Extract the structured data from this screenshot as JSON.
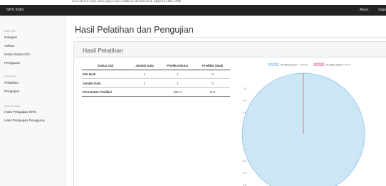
{
  "browser": {
    "url_text": "localhost/spk-knn/app/user/admin/dashboard.php?id=1&r=340"
  },
  "topbar": {
    "brand": "SPK KNN",
    "links": [
      "Akun",
      "Sign"
    ]
  },
  "sidebar": {
    "sections": [
      {
        "title": "MASTER",
        "items": [
          "Kategori",
          "Atribut",
          "Kelas Status Gizi",
          "Pengguna"
        ]
      },
      {
        "title": "PROSES",
        "items": [
          "Pelatihan",
          "Pengujian"
        ]
      },
      {
        "title": "PENGUJIAN",
        "items": [
          "Hasil Pengujian KNN",
          "Hasil Pengujian Pengguna"
        ]
      }
    ]
  },
  "page": {
    "title": "Hasil Pelatihan dan Pengujian"
  },
  "panel": {
    "title": "Hasil Pelatihan"
  },
  "table": {
    "headers": [
      "Status Gizi",
      "Jumlah Data",
      "Prediksi Benar",
      "Prediksi Salah"
    ],
    "rows": [
      [
        "Gizi Baik",
        "1",
        "1",
        "0"
      ],
      [
        "Jumlah Data",
        "1",
        "1",
        "0"
      ],
      [
        "Persentase Prediksi",
        "",
        "100 %",
        "0 %"
      ]
    ]
  },
  "chart_data": {
    "type": "pie",
    "labels": [
      "Prediksi Benar",
      "Prediksi Salah"
    ],
    "legend": [
      "Prediksi Benar = 100 %",
      "Prediksi Salah = 0 %"
    ],
    "values": [
      100,
      0
    ],
    "y_ticks": [
      "1.0",
      "0.9",
      "0.8",
      "0.7",
      "0.6",
      "0.5",
      "0.4",
      "0.3",
      "0.2"
    ],
    "colors": {
      "benar": "#cce6f6",
      "benar_border": "#8fc3e8",
      "salah": "#f7c7d0",
      "salah_border": "#e8657d"
    },
    "legend_position": "top"
  }
}
